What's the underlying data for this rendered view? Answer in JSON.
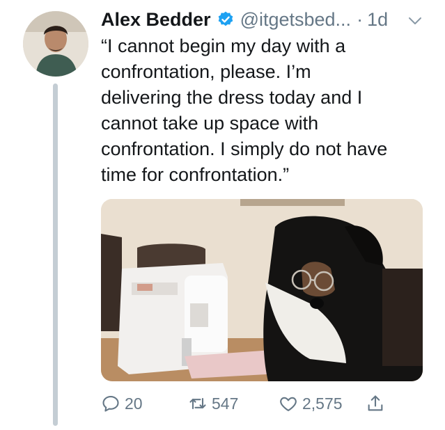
{
  "tweet": {
    "author_name": "Alex Bedder",
    "handle": "@itgetsbed...",
    "separator": "·",
    "time_ago": "1d",
    "text": "“I cannot begin my day with a\nconfrontation, please. I’m\ndelivering the dress today and I\ncannot take up space with\nconfrontation. I simply do not have\ntime for confrontation.”"
  },
  "actions": {
    "reply_count": "20",
    "retweet_count": "547",
    "like_count": "2,575"
  },
  "icons": {
    "verified": "verified-badge-icon",
    "caret": "chevron-down-icon",
    "reply": "speech-bubble-icon",
    "retweet": "retweet-arrows-icon",
    "like": "heart-icon",
    "share": "share-upload-icon"
  },
  "colors": {
    "verified_blue": "#1da1f2",
    "secondary_text": "#657786",
    "thread_line": "#c4cdd4"
  }
}
